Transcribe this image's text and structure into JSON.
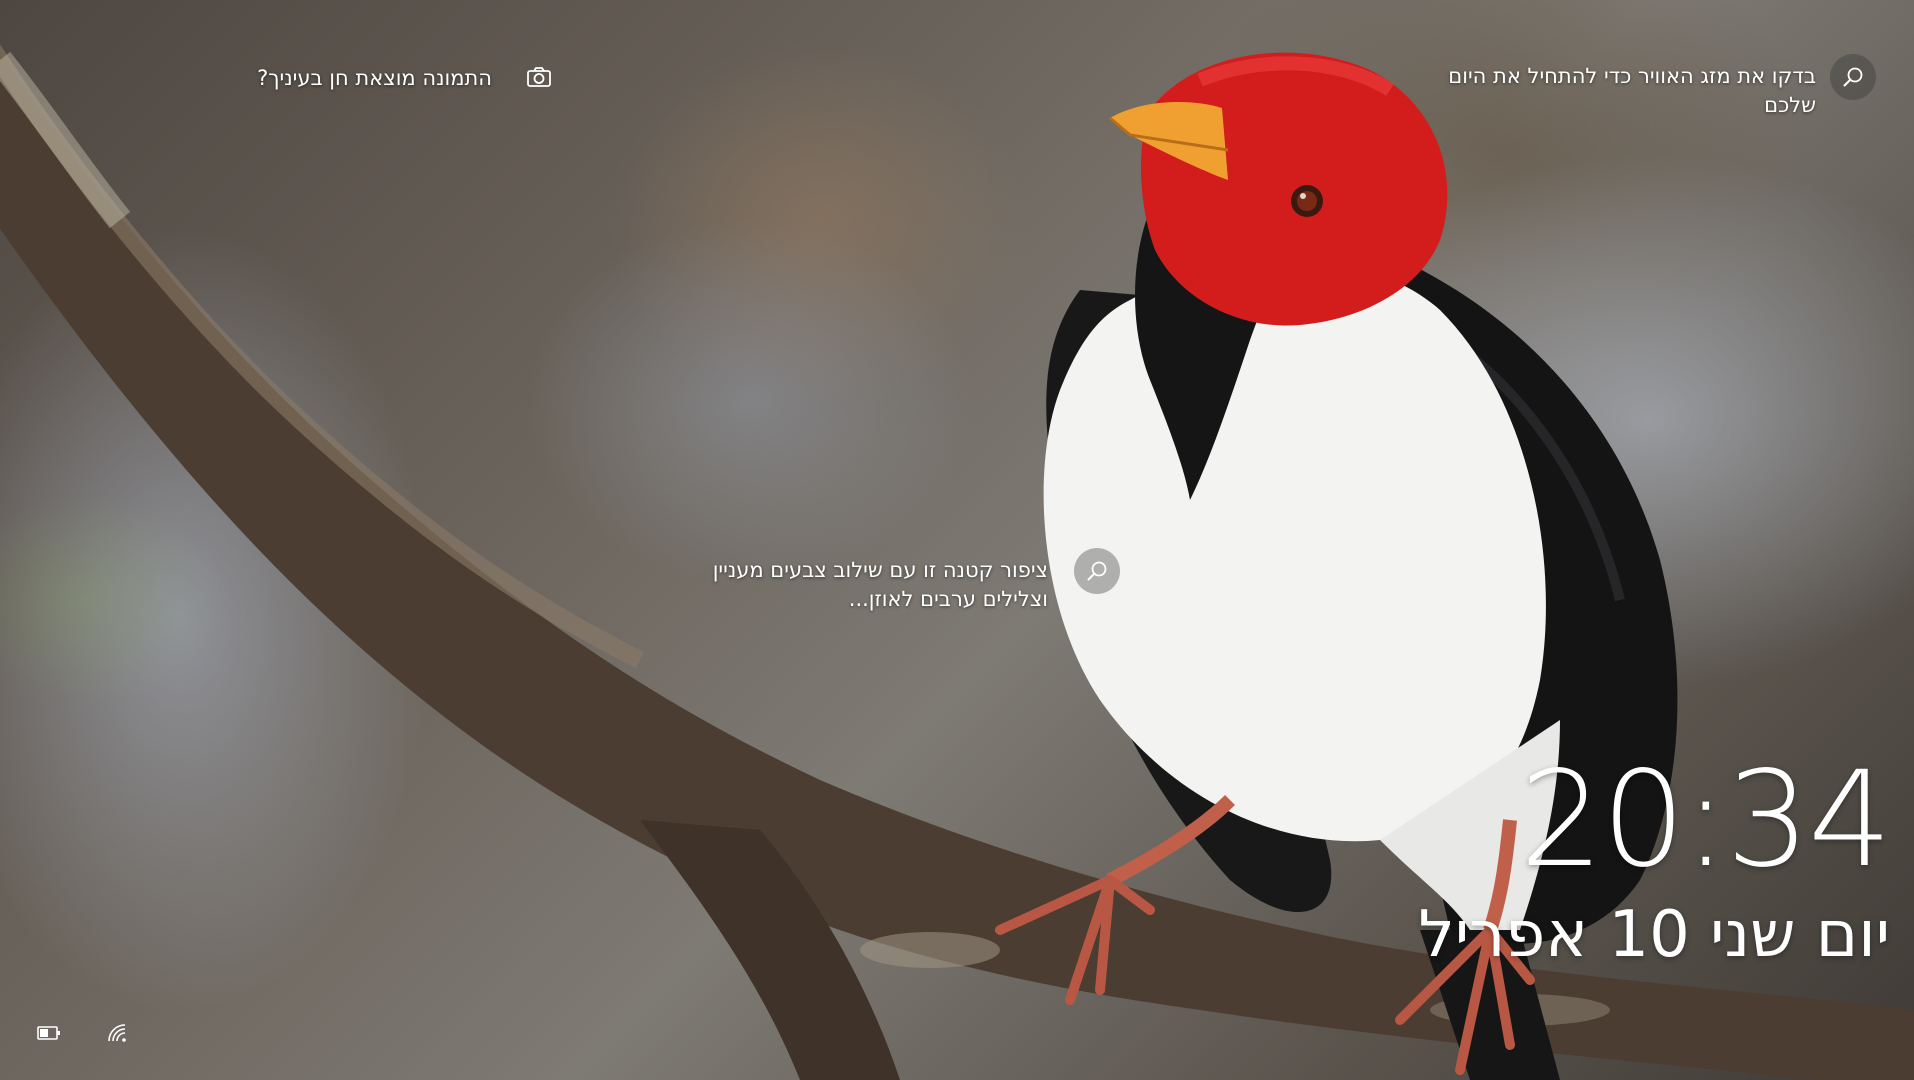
{
  "lock_screen": {
    "photo_prompt": {
      "text": "התמונה מוצאת חן בעיניך?",
      "icon": "camera-icon"
    },
    "weather_tip": {
      "text": "בדקו את מזג האוויר כדי להתחיל את היום שלכם",
      "icon": "search-icon"
    },
    "bird_tip": {
      "text": "ציפור קטנה זו עם שילוב צבעים מעניין וצלילים ערבים לאוזן...",
      "icon": "search-icon"
    },
    "clock": {
      "time": "20:34",
      "date": "יום שני 10 אפריל"
    },
    "status": {
      "battery_icon": "battery-icon",
      "network_icon": "wifi-icon"
    },
    "background": {
      "subject": "red-capped cardinal on branch",
      "colors": {
        "head": "#d62020",
        "beak": "#f0a030",
        "body": "#f4f4f2",
        "wing": "#141414",
        "branch": "#4a3a2e"
      }
    }
  }
}
